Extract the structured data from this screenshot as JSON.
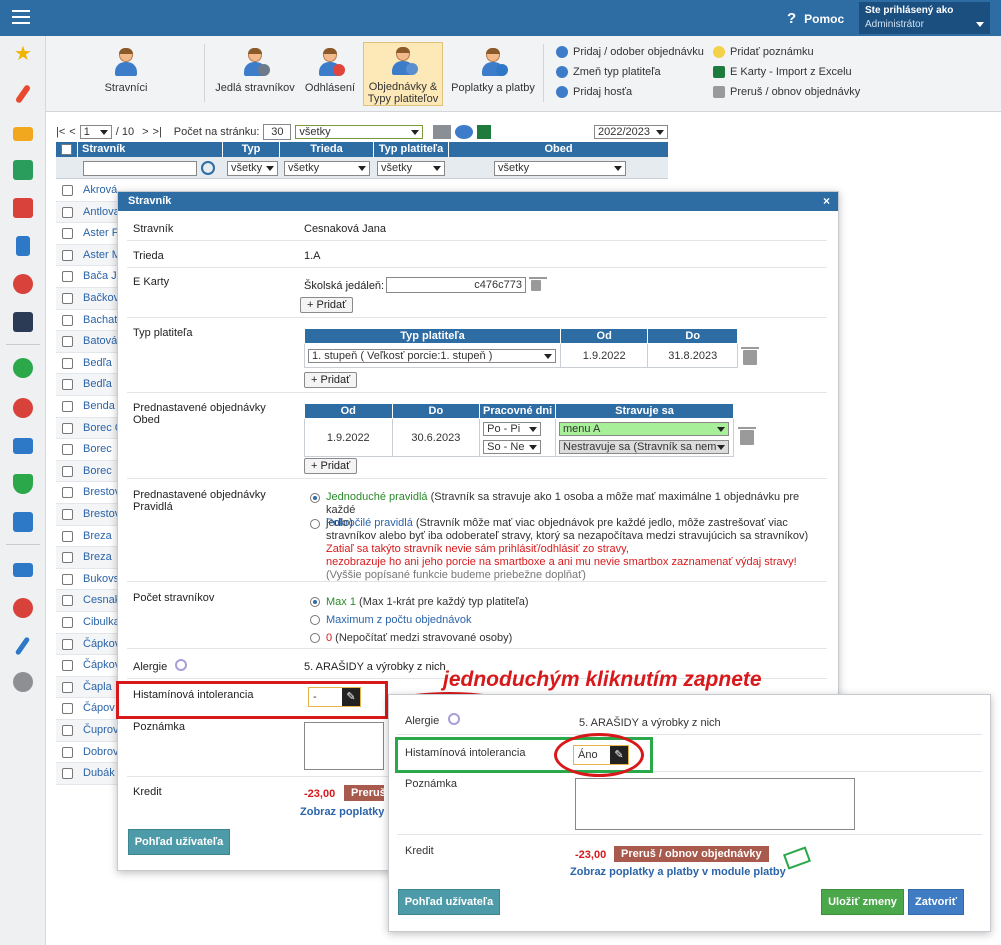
{
  "topbar": {
    "help_label": "Pomoc",
    "user_line1": "Ste prihlásený ako",
    "user_line2": "Administrátor"
  },
  "ribbon": {
    "buttons": [
      {
        "label": "Stravníci"
      },
      {
        "label": "Jedlá stravníkov"
      },
      {
        "label": "Odhlásení"
      },
      {
        "label": "Objednávky &"
      },
      {
        "label": "Typy platiteľov"
      },
      {
        "label": "Poplatky a platby"
      }
    ],
    "links": [
      "Pridaj / odober objednávku",
      "Zmeň typ platiteľa",
      "Pridaj hosťa",
      "Pridať poznámku",
      "E Karty - Import z Excelu",
      "Preruš / obnov objednávky"
    ]
  },
  "list": {
    "pager_first": "|<",
    "pager_prev": "<",
    "page": "1",
    "of_pages": "/ 10",
    "pager_next": ">",
    "pager_last": ">|",
    "per_page_label": "Počet na stránku:",
    "per_page": "30",
    "filter_all": "všetky",
    "year": "2022/2023",
    "headers": [
      "Stravník",
      "Typ",
      "Trieda",
      "Typ platiteľa",
      "Obed"
    ],
    "filter_values": [
      "všetky",
      "všetky",
      "všetky",
      "všetky"
    ],
    "rows": [
      "Akrová",
      "Antlova",
      "Aster F",
      "Aster M",
      "Bača J",
      "Bačkov",
      "Bachat",
      "Batová",
      "Bedľa",
      "Bedľa",
      "Benda",
      "Borec C",
      "Borec",
      "Borec",
      "Brestov",
      "Brestov",
      "Breza",
      "Breza",
      "Bukovs",
      "Cesnak",
      "Cibulka",
      "Čápkov",
      "Čápkov",
      "Čapla",
      "Čápov",
      "Čuprov",
      "Dobrov",
      "Dubák"
    ]
  },
  "modal": {
    "title": "Stravník",
    "close": "×",
    "stravnik_label": "Stravník",
    "stravnik_value": "Cesnaková Jana",
    "trieda_label": "Trieda",
    "trieda_value": "1.A",
    "ekarty_label": "E Karty",
    "ekarty_field_label": "Školská jedáleň:",
    "ekarty_value": "c476c773",
    "pridat": "+ Pridať",
    "typ_label": "Typ platiteľa",
    "typ_headers": [
      "Typ platiteľa",
      "Od",
      "Do"
    ],
    "typ_row": {
      "typ": "1. stupeň ( Veľkosť porcie:1. stupeň )",
      "od": "1.9.2022",
      "do": "31.8.2023"
    },
    "pred_label1": "Prednastavené objednávky",
    "pred_label2": "Obed",
    "pred_headers": [
      "Od",
      "Do",
      "Pracovné dni",
      "Stravuje sa"
    ],
    "pred_row": {
      "od": "1.9.2022",
      "do": "30.6.2023",
      "dni1": "Po - Pi",
      "dni2": "So - Ne",
      "menu1": "menu A",
      "menu2": "Nestravuje sa (Stravník sa nem"
    },
    "prav_label1": "Prednastavené objednávky",
    "prav_label2": "Pravidlá",
    "prav_opt1_title": "Jednoduché pravidlá",
    "prav_opt1_text": " (Stravník sa stravuje ako 1 osoba a môže mať maximálne 1 objednávku pre každé",
    "prav_opt1_text2": "jedlo)",
    "prav_opt2_title": "Pokročilé pravidlá",
    "prav_opt2_text": " (Stravník môže mať viac objednávok pre každé jedlo, môže zastrešovať viac",
    "prav_opt2_text2": "stravníkov alebo byť iba odoberateľ stravy, ktorý sa nezapočítava medzi stravujúcich sa stravníkov)",
    "prav_warn1": "Zatiaľ sa takýto stravník nevie sám prihlásiť/odhlásiť zo stravy,",
    "prav_warn2": "nezobrazuje ho ani jeho porcie na smartboxe a ani mu nevie smartbox zaznamenať výdaj stravy!",
    "prav_note": "(Vyššie popísané funkcie budeme priebežne doplňať)",
    "pocet_label": "Počet stravníkov",
    "pocet_opt1_title": "Max 1",
    "pocet_opt1_text": " (Max 1-krát pre každý typ platiteľa)",
    "pocet_opt2_title": "Maximum z počtu objednávok",
    "pocet_opt3_title": "0",
    "pocet_opt3_text": " (Nepočítať medzi stravované osoby)",
    "alergie_label": "Alergie",
    "alergie_value": "5. ARAŠIDY a výrobky z nich",
    "hist_label": "Histamínová intolerancia",
    "hist_value": "-",
    "poznamka_label": "Poznámka",
    "kredit_label": "Kredit",
    "kredit_value": "-23,00",
    "prerus_btn": "Preruš / obnov objednávky",
    "zobraz_link": "Zobraz poplatky a platby v module platby",
    "pohlad_btn": "Pohľad užívateľa"
  },
  "annotation": "jednoduchým kliknutím zapnete",
  "zoom": {
    "alergie_label": "Alergie",
    "alergie_value": "5. ARAŠIDY a výrobky z nich",
    "hist_label": "Histamínová intolerancia",
    "hist_value": "Áno",
    "poznamka_label": "Poznámka",
    "kredit_label": "Kredit",
    "kredit_value": "-23,00",
    "prerus_btn": "Preruš / obnov objednávky",
    "zobraz_link": "Zobraz poplatky a platby v module platby",
    "pohlad_btn": "Pohľad užívateľa",
    "ulozit_btn": "Uložiť zmeny",
    "zatvorit_btn": "Zatvoriť"
  },
  "colors": {
    "primary": "#2e6ca4",
    "annotation": "#d8191b",
    "highlight_green": "#2aa84a"
  }
}
